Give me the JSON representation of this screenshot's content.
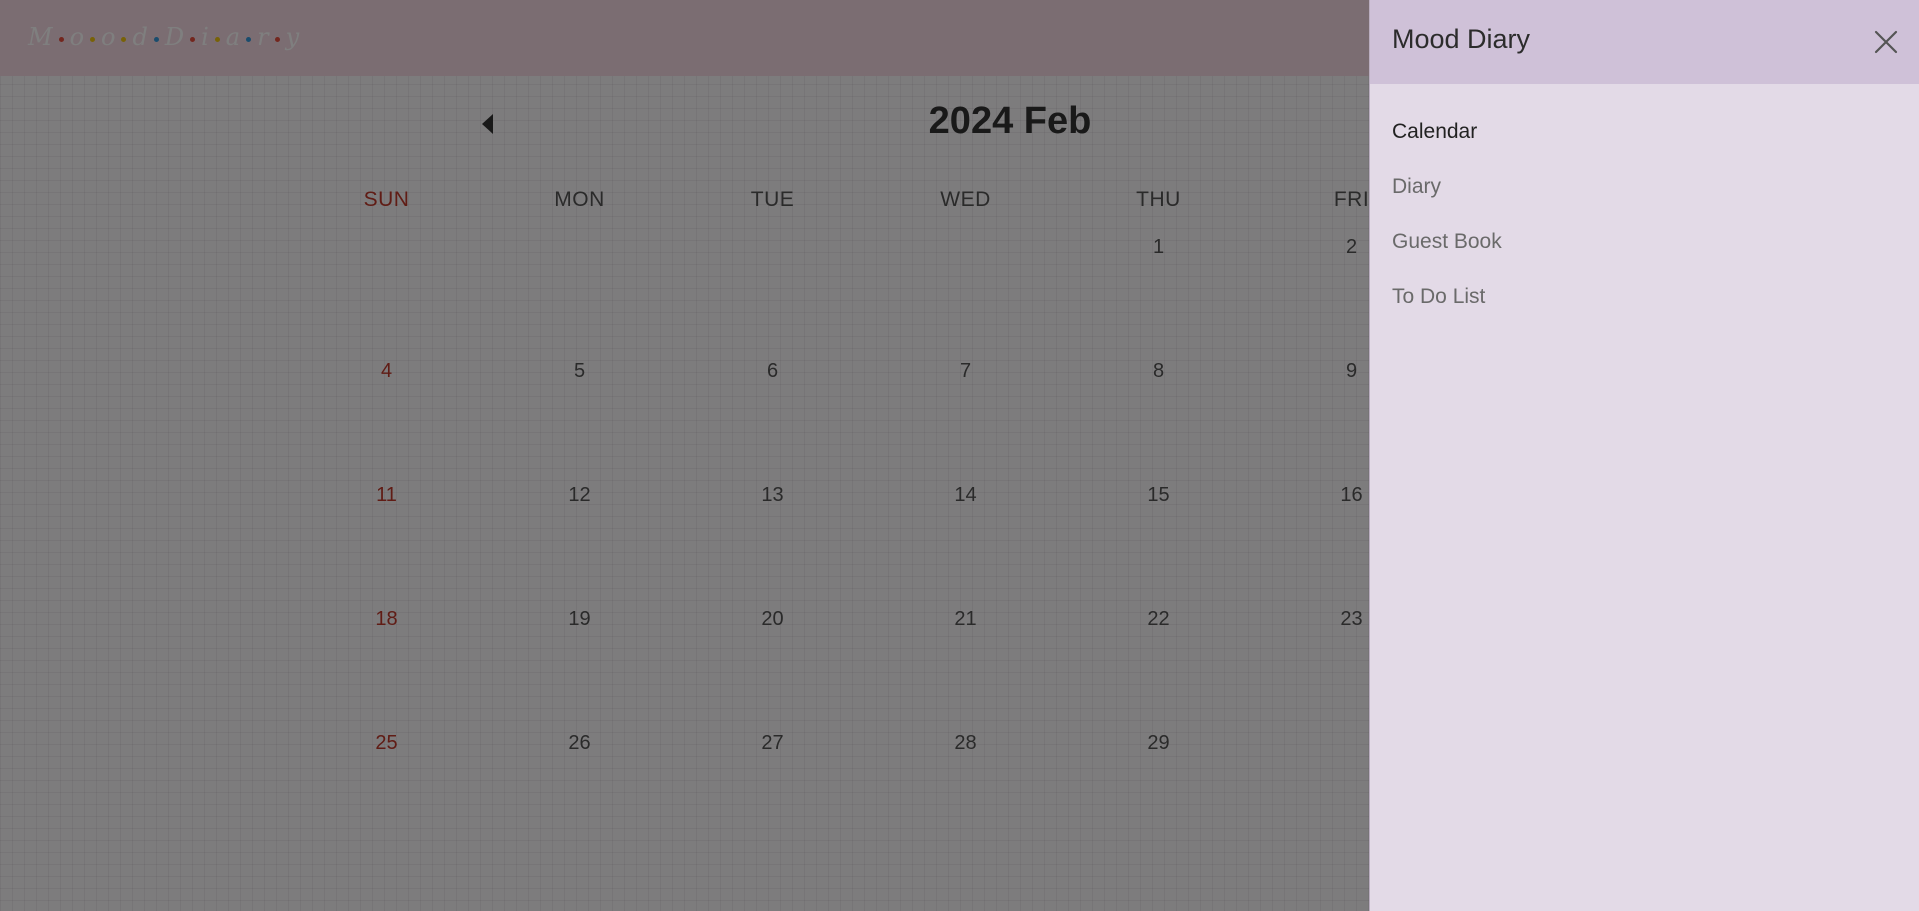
{
  "app": {
    "logo_letters": [
      "M",
      "o",
      "o",
      "d",
      "D",
      "i",
      "a",
      "r",
      "y"
    ],
    "logo_dot_colors": [
      "#e74c3c",
      "#f1c40f",
      "#f1c40f",
      "#3498db",
      "#e74c3c",
      "#f1c40f",
      "#3498db",
      "#e74c3c",
      "#f1c40f"
    ]
  },
  "calendar": {
    "title": "2024 Feb",
    "weekdays": [
      "SUN",
      "MON",
      "TUE",
      "WED",
      "THU",
      "FRI"
    ],
    "weeks": [
      [
        "",
        "",
        "",
        "",
        "1",
        "2"
      ],
      [
        "4",
        "5",
        "6",
        "7",
        "8",
        "9"
      ],
      [
        "11",
        "12",
        "13",
        "14",
        "15",
        "16"
      ],
      [
        "18",
        "19",
        "20",
        "21",
        "22",
        "23"
      ],
      [
        "25",
        "26",
        "27",
        "28",
        "29",
        ""
      ]
    ],
    "sunday_color": "#c0392b"
  },
  "drawer": {
    "title": "Mood Diary",
    "nav": [
      {
        "label": "Calendar",
        "active": true
      },
      {
        "label": "Diary",
        "active": false
      },
      {
        "label": "Guest Book",
        "active": false
      },
      {
        "label": "To Do List",
        "active": false
      }
    ],
    "header_color": "#cfc1d8",
    "background_color": "#e3dae7"
  },
  "icons": {
    "prev": "caret-left-icon",
    "close": "close-icon"
  }
}
